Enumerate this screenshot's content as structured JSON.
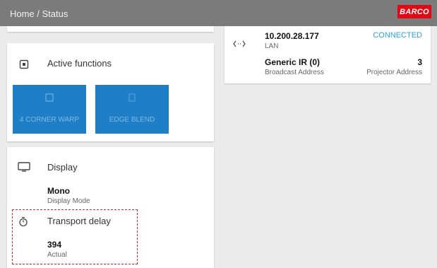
{
  "header": {
    "breadcrumb": "Home / Status",
    "logo_text": "BARCO",
    "logo_color": "#e30613",
    "bar_color": "#7b7b7b"
  },
  "active_functions": {
    "title": "Active functions",
    "icon": "active-functions-icon",
    "tiles": [
      {
        "label": "4 CORNER WARP",
        "icon": "corner-warp-icon"
      },
      {
        "label": "EDGE BLEND",
        "icon": "edge-blend-icon"
      }
    ],
    "tile_color": "#1e7fc6"
  },
  "display": {
    "title": "Display",
    "icon": "monitor-icon",
    "mode_value": "Mono",
    "mode_label": "Display Mode"
  },
  "transport_delay": {
    "title": "Transport delay",
    "icon": "stopwatch-icon",
    "value": "394",
    "label": "Actual"
  },
  "connection": {
    "icon": "network-arrows-icon",
    "ip": "10.200.28.177",
    "ip_label": "LAN",
    "status": "CONNECTED",
    "status_color": "#29a3e0",
    "ir_value": "Generic IR (0)",
    "ir_label": "Broadcast Address",
    "projector_address": "3",
    "projector_address_label": "Projector Address"
  }
}
